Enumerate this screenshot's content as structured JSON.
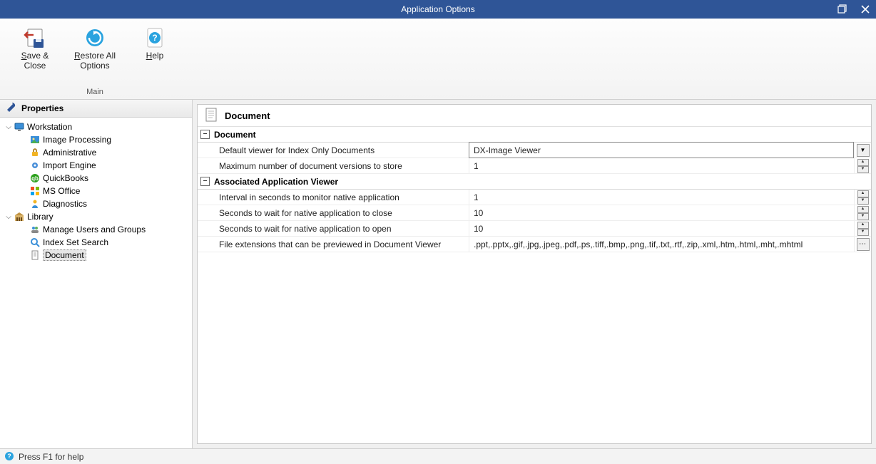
{
  "title": "Application Options",
  "ribbon": {
    "group_label": "Main",
    "save_close": "Save & Close",
    "restore_all": "Restore All Options",
    "help": "Help",
    "save_close_u": "S",
    "restore_all_u": "R",
    "help_u": "H"
  },
  "sidebar": {
    "header": "Properties",
    "workstation": "Workstation",
    "image_processing": "Image Processing",
    "administrative": "Administrative",
    "import_engine": "Import Engine",
    "quickbooks": "QuickBooks",
    "ms_office": "MS Office",
    "diagnostics": "Diagnostics",
    "library": "Library",
    "manage_users": "Manage Users and Groups",
    "index_set_search": "Index Set Search",
    "document": "Document"
  },
  "content": {
    "title": "Document",
    "section_document": "Document",
    "section_assoc": "Associated Application Viewer",
    "rows": {
      "default_viewer_label": "Default viewer for Index Only Documents",
      "default_viewer_value": "DX-Image Viewer",
      "max_versions_label": "Maximum number of document versions to store",
      "max_versions_value": "1",
      "interval_label": "Interval in seconds to monitor native application",
      "interval_value": "1",
      "wait_close_label": "Seconds to wait for native application to close",
      "wait_close_value": "10",
      "wait_open_label": "Seconds to wait for native application to open",
      "wait_open_value": "10",
      "file_ext_label": "File extensions that can be previewed in Document Viewer",
      "file_ext_value": ".ppt,.pptx,.gif,.jpg,.jpeg,.pdf,.ps,.tiff,.bmp,.png,.tif,.txt,.rtf,.zip,.xml,.htm,.html,.mht,.mhtml"
    }
  },
  "statusbar": {
    "text": "Press F1 for help"
  }
}
